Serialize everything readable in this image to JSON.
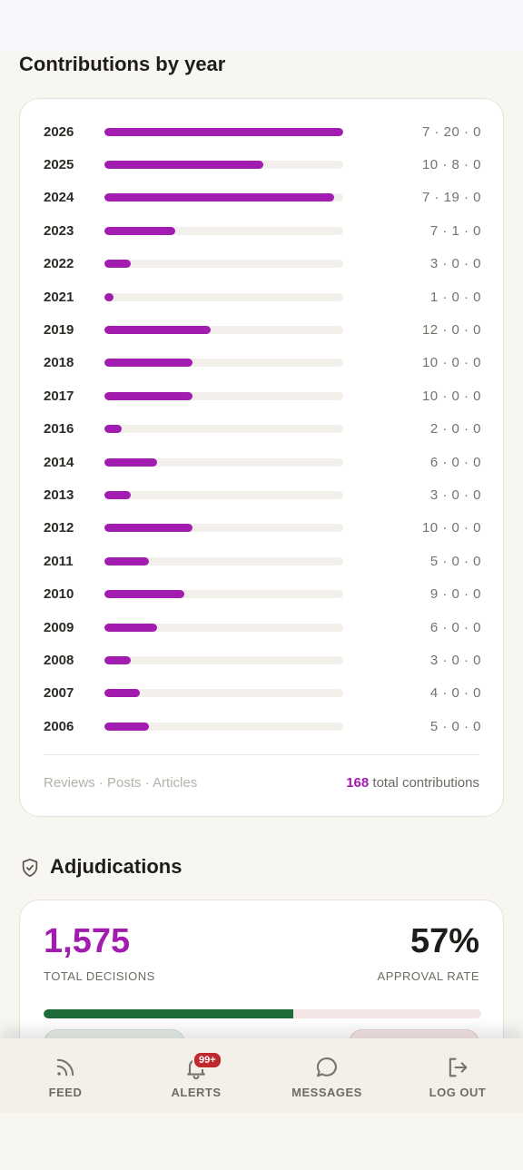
{
  "contributions": {
    "title": "Contributions by year",
    "max_total": 27,
    "rows": [
      {
        "year": "2026",
        "total": 27,
        "counts": "7 · 20 · 0"
      },
      {
        "year": "2025",
        "total": 18,
        "counts": "10 · 8 · 0"
      },
      {
        "year": "2024",
        "total": 26,
        "counts": "7 · 19 · 0"
      },
      {
        "year": "2023",
        "total": 8,
        "counts": "7 · 1 · 0"
      },
      {
        "year": "2022",
        "total": 3,
        "counts": "3 · 0 · 0"
      },
      {
        "year": "2021",
        "total": 1,
        "counts": "1 · 0 · 0"
      },
      {
        "year": "2019",
        "total": 12,
        "counts": "12 · 0 · 0"
      },
      {
        "year": "2018",
        "total": 10,
        "counts": "10 · 0 · 0"
      },
      {
        "year": "2017",
        "total": 10,
        "counts": "10 · 0 · 0"
      },
      {
        "year": "2016",
        "total": 2,
        "counts": "2 · 0 · 0"
      },
      {
        "year": "2014",
        "total": 6,
        "counts": "6 · 0 · 0"
      },
      {
        "year": "2013",
        "total": 3,
        "counts": "3 · 0 · 0"
      },
      {
        "year": "2012",
        "total": 10,
        "counts": "10 · 0 · 0"
      },
      {
        "year": "2011",
        "total": 5,
        "counts": "5 · 0 · 0"
      },
      {
        "year": "2010",
        "total": 9,
        "counts": "9 · 0 · 0"
      },
      {
        "year": "2009",
        "total": 6,
        "counts": "6 · 0 · 0"
      },
      {
        "year": "2008",
        "total": 3,
        "counts": "3 · 0 · 0"
      },
      {
        "year": "2007",
        "total": 4,
        "counts": "4 · 0 · 0"
      },
      {
        "year": "2006",
        "total": 5,
        "counts": "5 · 0 · 0"
      }
    ],
    "legend": "Reviews · Posts · Articles",
    "total_count": "168",
    "total_suffix": "total contributions",
    "bar_color": "#a21caf"
  },
  "adjudications": {
    "title": "Adjudications",
    "icon": "shield-check-icon",
    "total_decisions": "1,575",
    "total_label": "TOTAL DECISIONS",
    "approval_rate": "57%",
    "approval_label": "APPROVAL RATE",
    "approval_fraction": 0.57,
    "approve_color": "#1e6b3a",
    "reject_color": "#f5e6e6"
  },
  "nav": {
    "items": [
      {
        "label": "FEED",
        "icon": "rss-icon"
      },
      {
        "label": "ALERTS",
        "icon": "bell-icon",
        "badge": "99+"
      },
      {
        "label": "MESSAGES",
        "icon": "chat-bubble-icon"
      },
      {
        "label": "LOG OUT",
        "icon": "logout-icon"
      }
    ]
  }
}
